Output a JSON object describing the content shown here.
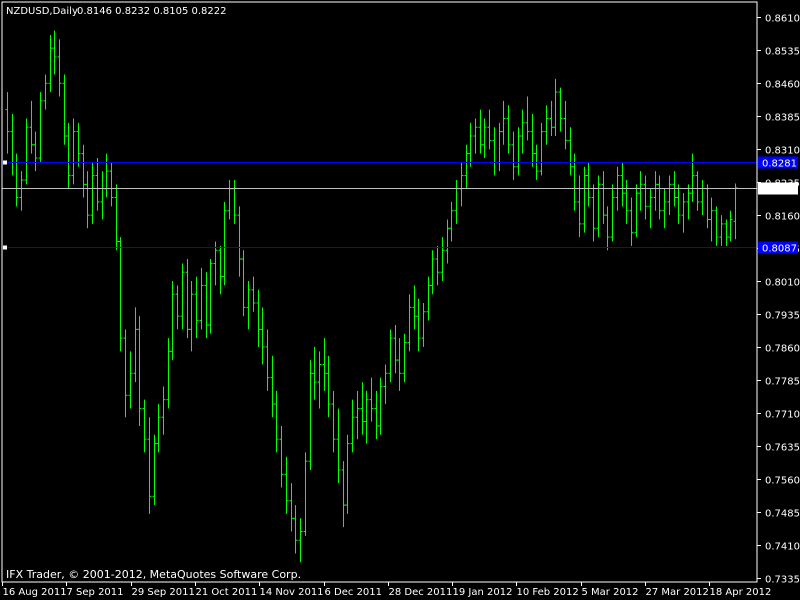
{
  "chart_data": {
    "type": "ohlc",
    "title": "NZDUSD,Daily",
    "ohlc_header": "0.8146 0.8232 0.8105 0.8222",
    "copyright": "IFX Trader, © 2001-2012, MetaQuotes Software Corp.",
    "ylim": [
      0.7325,
      0.8645
    ],
    "y_ticks": [
      "0.8610",
      "0.8535",
      "0.8460",
      "0.8385",
      "0.8310",
      "0.8235",
      "0.8160",
      "0.8085",
      "0.8010",
      "0.7935",
      "0.7860",
      "0.7785",
      "0.7710",
      "0.7635",
      "0.7560",
      "0.7485",
      "0.7410",
      "0.7335"
    ],
    "x_ticks": [
      "16 Aug 2011",
      "7 Sep 2011",
      "29 Sep 2011",
      "21 Oct 2011",
      "14 Nov 2011",
      "6 Dec 2011",
      "28 Dec 2011",
      "19 Jan 2012",
      "10 Feb 2012",
      "5 Mar 2012",
      "27 Mar 2012",
      "18 Apr 2012"
    ],
    "current_price": "0.8222",
    "horizontal_lines": [
      {
        "label": "0.8281",
        "value": 0.8281,
        "color": "#0000ff"
      },
      {
        "label": "0.8087",
        "value": 0.8087,
        "color": "#0000ff"
      }
    ],
    "colors": {
      "bars": "#00ff00",
      "background": "#000000",
      "axis": "#ffffff",
      "price_line": "#c0c0c0"
    },
    "bars": [
      [
        0.84,
        0.844,
        0.83,
        0.835
      ],
      [
        0.835,
        0.839,
        0.825,
        0.828
      ],
      [
        0.828,
        0.83,
        0.818,
        0.82
      ],
      [
        0.82,
        0.826,
        0.817,
        0.824
      ],
      [
        0.824,
        0.838,
        0.823,
        0.836
      ],
      [
        0.836,
        0.842,
        0.83,
        0.832
      ],
      [
        0.832,
        0.835,
        0.826,
        0.829
      ],
      [
        0.829,
        0.844,
        0.828,
        0.842
      ],
      [
        0.842,
        0.848,
        0.84,
        0.846
      ],
      [
        0.846,
        0.857,
        0.844,
        0.854
      ],
      [
        0.854,
        0.858,
        0.848,
        0.852
      ],
      [
        0.852,
        0.856,
        0.843,
        0.846
      ],
      [
        0.846,
        0.848,
        0.832,
        0.834
      ],
      [
        0.834,
        0.837,
        0.822,
        0.825
      ],
      [
        0.825,
        0.838,
        0.823,
        0.835
      ],
      [
        0.835,
        0.837,
        0.827,
        0.83
      ],
      [
        0.83,
        0.832,
        0.82,
        0.823
      ],
      [
        0.823,
        0.826,
        0.813,
        0.816
      ],
      [
        0.816,
        0.828,
        0.814,
        0.825
      ],
      [
        0.825,
        0.829,
        0.817,
        0.819
      ],
      [
        0.819,
        0.826,
        0.815,
        0.822
      ],
      [
        0.822,
        0.83,
        0.82,
        0.826
      ],
      [
        0.826,
        0.828,
        0.818,
        0.82
      ],
      [
        0.82,
        0.823,
        0.808,
        0.81
      ],
      [
        0.81,
        0.811,
        0.785,
        0.788
      ],
      [
        0.788,
        0.79,
        0.77,
        0.775
      ],
      [
        0.775,
        0.785,
        0.772,
        0.78
      ],
      [
        0.78,
        0.795,
        0.778,
        0.79
      ],
      [
        0.79,
        0.793,
        0.768,
        0.772
      ],
      [
        0.772,
        0.774,
        0.762,
        0.765
      ],
      [
        0.765,
        0.77,
        0.748,
        0.752
      ],
      [
        0.752,
        0.766,
        0.75,
        0.764
      ],
      [
        0.764,
        0.773,
        0.762,
        0.77
      ],
      [
        0.77,
        0.777,
        0.766,
        0.774
      ],
      [
        0.774,
        0.788,
        0.772,
        0.785
      ],
      [
        0.785,
        0.801,
        0.783,
        0.798
      ],
      [
        0.798,
        0.8,
        0.79,
        0.793
      ],
      [
        0.793,
        0.805,
        0.79,
        0.803
      ],
      [
        0.803,
        0.806,
        0.788,
        0.79
      ],
      [
        0.79,
        0.801,
        0.785,
        0.798
      ],
      [
        0.798,
        0.802,
        0.788,
        0.792
      ],
      [
        0.792,
        0.804,
        0.79,
        0.8
      ],
      [
        0.8,
        0.803,
        0.788,
        0.791
      ],
      [
        0.791,
        0.806,
        0.789,
        0.805
      ],
      [
        0.805,
        0.81,
        0.8,
        0.808
      ],
      [
        0.808,
        0.809,
        0.798,
        0.802
      ],
      [
        0.802,
        0.819,
        0.8,
        0.817
      ],
      [
        0.817,
        0.824,
        0.815,
        0.822
      ],
      [
        0.822,
        0.824,
        0.814,
        0.816
      ],
      [
        0.816,
        0.818,
        0.802,
        0.806
      ],
      [
        0.806,
        0.808,
        0.793,
        0.795
      ],
      [
        0.795,
        0.801,
        0.79,
        0.799
      ],
      [
        0.799,
        0.802,
        0.794,
        0.796
      ],
      [
        0.796,
        0.799,
        0.786,
        0.79
      ],
      [
        0.79,
        0.795,
        0.782,
        0.786
      ],
      [
        0.786,
        0.79,
        0.776,
        0.779
      ],
      [
        0.779,
        0.784,
        0.77,
        0.773
      ],
      [
        0.773,
        0.776,
        0.762,
        0.765
      ],
      [
        0.765,
        0.768,
        0.754,
        0.757
      ],
      [
        0.757,
        0.761,
        0.748,
        0.751
      ],
      [
        0.751,
        0.755,
        0.744,
        0.747
      ],
      [
        0.747,
        0.75,
        0.739,
        0.742
      ],
      [
        0.742,
        0.747,
        0.737,
        0.744
      ],
      [
        0.744,
        0.762,
        0.743,
        0.76
      ],
      [
        0.76,
        0.783,
        0.758,
        0.78
      ],
      [
        0.78,
        0.786,
        0.774,
        0.778
      ],
      [
        0.778,
        0.785,
        0.772,
        0.782
      ],
      [
        0.782,
        0.788,
        0.776,
        0.78
      ],
      [
        0.78,
        0.784,
        0.77,
        0.773
      ],
      [
        0.773,
        0.776,
        0.762,
        0.765
      ],
      [
        0.765,
        0.772,
        0.755,
        0.758
      ],
      [
        0.758,
        0.76,
        0.745,
        0.75
      ],
      [
        0.75,
        0.766,
        0.748,
        0.764
      ],
      [
        0.764,
        0.774,
        0.762,
        0.77
      ],
      [
        0.77,
        0.776,
        0.765,
        0.772
      ],
      [
        0.772,
        0.778,
        0.766,
        0.769
      ],
      [
        0.769,
        0.776,
        0.764,
        0.774
      ],
      [
        0.774,
        0.779,
        0.769,
        0.772
      ],
      [
        0.772,
        0.776,
        0.765,
        0.768
      ],
      [
        0.768,
        0.779,
        0.766,
        0.777
      ],
      [
        0.777,
        0.782,
        0.773,
        0.78
      ],
      [
        0.78,
        0.79,
        0.778,
        0.788
      ],
      [
        0.788,
        0.791,
        0.78,
        0.783
      ],
      [
        0.783,
        0.788,
        0.776,
        0.78
      ],
      [
        0.78,
        0.789,
        0.778,
        0.787
      ],
      [
        0.787,
        0.798,
        0.785,
        0.795
      ],
      [
        0.795,
        0.8,
        0.79,
        0.793
      ],
      [
        0.793,
        0.797,
        0.785,
        0.788
      ],
      [
        0.788,
        0.796,
        0.786,
        0.794
      ],
      [
        0.794,
        0.802,
        0.792,
        0.8
      ],
      [
        0.8,
        0.808,
        0.798,
        0.806
      ],
      [
        0.806,
        0.809,
        0.8,
        0.803
      ],
      [
        0.803,
        0.811,
        0.801,
        0.808
      ],
      [
        0.808,
        0.815,
        0.805,
        0.813
      ],
      [
        0.813,
        0.819,
        0.81,
        0.817
      ],
      [
        0.817,
        0.824,
        0.814,
        0.822
      ],
      [
        0.822,
        0.828,
        0.818,
        0.825
      ],
      [
        0.825,
        0.832,
        0.822,
        0.83
      ],
      [
        0.83,
        0.837,
        0.827,
        0.834
      ],
      [
        0.834,
        0.838,
        0.83,
        0.836
      ],
      [
        0.836,
        0.84,
        0.83,
        0.832
      ],
      [
        0.832,
        0.838,
        0.829,
        0.836
      ],
      [
        0.836,
        0.84,
        0.831,
        0.833
      ],
      [
        0.833,
        0.836,
        0.825,
        0.828
      ],
      [
        0.828,
        0.837,
        0.826,
        0.835
      ],
      [
        0.835,
        0.842,
        0.832,
        0.838
      ],
      [
        0.838,
        0.841,
        0.83,
        0.832
      ],
      [
        0.832,
        0.835,
        0.824,
        0.827
      ],
      [
        0.827,
        0.836,
        0.825,
        0.834
      ],
      [
        0.834,
        0.84,
        0.83,
        0.837
      ],
      [
        0.837,
        0.843,
        0.833,
        0.835
      ],
      [
        0.835,
        0.839,
        0.827,
        0.83
      ],
      [
        0.83,
        0.832,
        0.824,
        0.826
      ],
      [
        0.826,
        0.837,
        0.825,
        0.835
      ],
      [
        0.835,
        0.841,
        0.832,
        0.838
      ],
      [
        0.838,
        0.842,
        0.834,
        0.836
      ],
      [
        0.836,
        0.847,
        0.834,
        0.844
      ],
      [
        0.844,
        0.845,
        0.835,
        0.838
      ],
      [
        0.838,
        0.842,
        0.831,
        0.833
      ],
      [
        0.833,
        0.836,
        0.825,
        0.827
      ],
      [
        0.827,
        0.83,
        0.817,
        0.819
      ],
      [
        0.819,
        0.825,
        0.811,
        0.814
      ],
      [
        0.814,
        0.827,
        0.812,
        0.825
      ],
      [
        0.825,
        0.828,
        0.818,
        0.82
      ],
      [
        0.82,
        0.823,
        0.81,
        0.813
      ],
      [
        0.813,
        0.825,
        0.811,
        0.823
      ],
      [
        0.823,
        0.826,
        0.814,
        0.816
      ],
      [
        0.816,
        0.818,
        0.808,
        0.811
      ],
      [
        0.811,
        0.823,
        0.81,
        0.82
      ],
      [
        0.82,
        0.827,
        0.817,
        0.825
      ],
      [
        0.825,
        0.828,
        0.818,
        0.821
      ],
      [
        0.821,
        0.824,
        0.814,
        0.817
      ],
      [
        0.817,
        0.82,
        0.809,
        0.812
      ],
      [
        0.812,
        0.823,
        0.811,
        0.821
      ],
      [
        0.821,
        0.826,
        0.817,
        0.823
      ],
      [
        0.823,
        0.825,
        0.815,
        0.818
      ],
      [
        0.818,
        0.822,
        0.813,
        0.82
      ],
      [
        0.82,
        0.826,
        0.817,
        0.823
      ],
      [
        0.823,
        0.825,
        0.815,
        0.817
      ],
      [
        0.817,
        0.822,
        0.813,
        0.819
      ],
      [
        0.819,
        0.825,
        0.816,
        0.823
      ],
      [
        0.823,
        0.826,
        0.818,
        0.82
      ],
      [
        0.82,
        0.823,
        0.814,
        0.816
      ],
      [
        0.816,
        0.821,
        0.812,
        0.819
      ],
      [
        0.819,
        0.823,
        0.815,
        0.821
      ],
      [
        0.821,
        0.83,
        0.819,
        0.825
      ],
      [
        0.825,
        0.826,
        0.817,
        0.819
      ],
      [
        0.819,
        0.824,
        0.816,
        0.822
      ],
      [
        0.822,
        0.823,
        0.813,
        0.815
      ],
      [
        0.815,
        0.82,
        0.81,
        0.817
      ],
      [
        0.817,
        0.818,
        0.809,
        0.811
      ],
      [
        0.811,
        0.816,
        0.809,
        0.814
      ],
      [
        0.814,
        0.815,
        0.809,
        0.811
      ],
      [
        0.811,
        0.817,
        0.81,
        0.815
      ],
      [
        0.8146,
        0.8232,
        0.8105,
        0.8222
      ]
    ]
  }
}
